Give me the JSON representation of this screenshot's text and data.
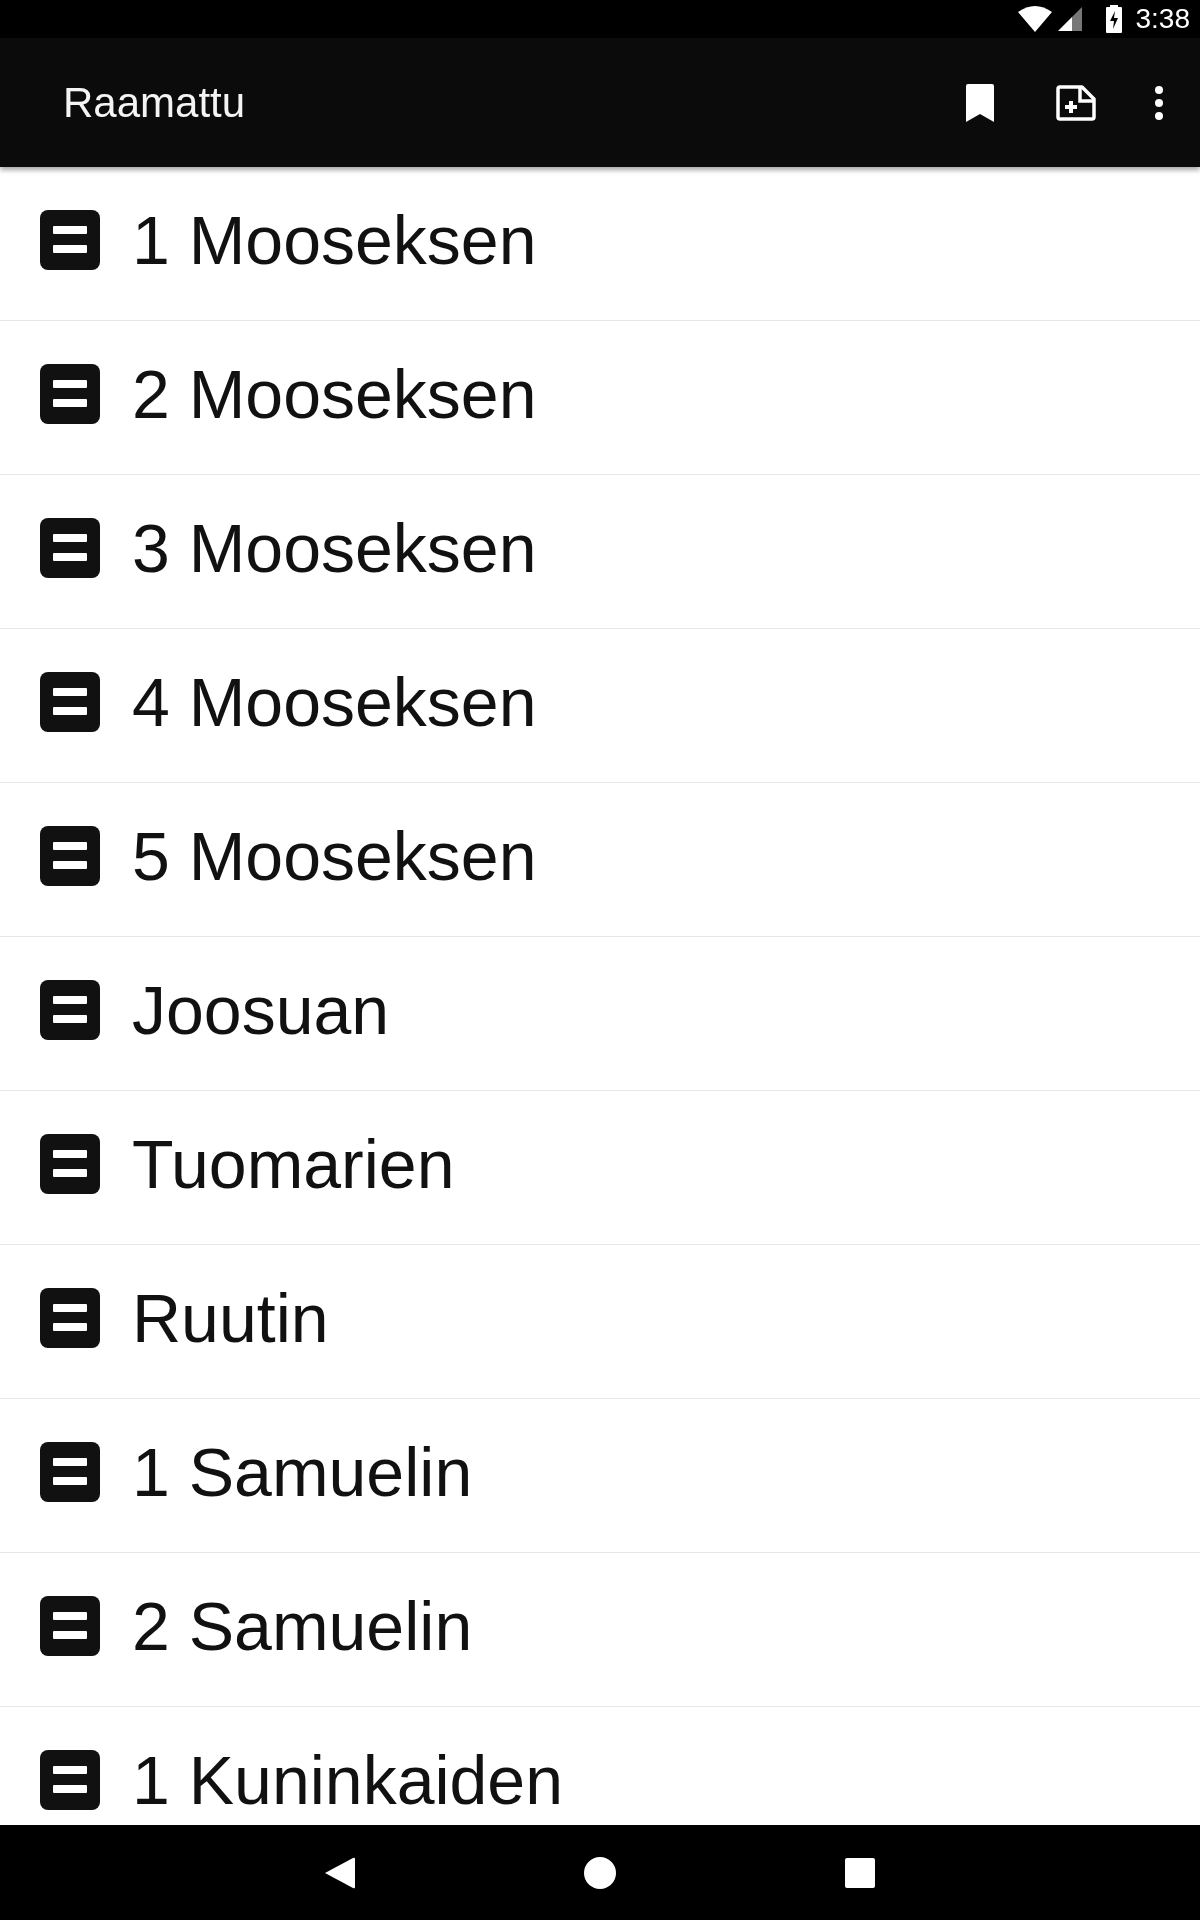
{
  "status_bar": {
    "time": "3:38"
  },
  "app_bar": {
    "title": "Raamattu"
  },
  "books": [
    {
      "name": "1 Mooseksen"
    },
    {
      "name": "2 Mooseksen"
    },
    {
      "name": "3 Mooseksen"
    },
    {
      "name": "4 Mooseksen"
    },
    {
      "name": "5 Mooseksen"
    },
    {
      "name": "Joosuan"
    },
    {
      "name": "Tuomarien"
    },
    {
      "name": "Ruutin"
    },
    {
      "name": "1 Samuelin"
    },
    {
      "name": "2 Samuelin"
    },
    {
      "name": "1 Kuninkaiden"
    }
  ]
}
